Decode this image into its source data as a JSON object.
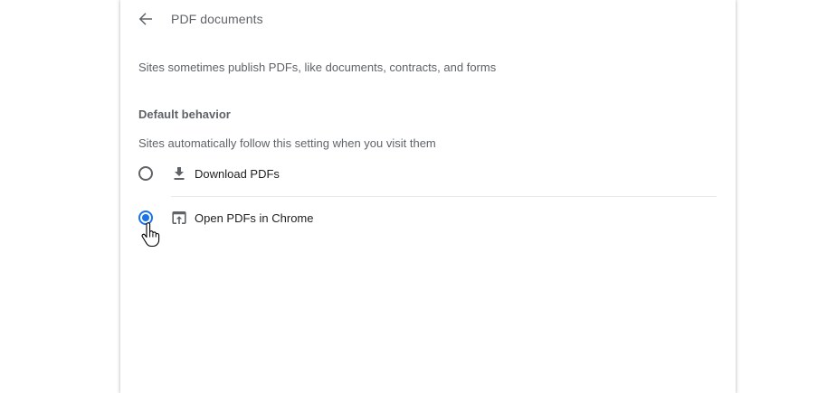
{
  "header": {
    "title": "PDF documents",
    "back_icon": "arrow-back-icon"
  },
  "description": "Sites sometimes publish PDFs, like documents, contracts, and forms",
  "default_behavior": {
    "title": "Default behavior",
    "subtitle": "Sites automatically follow this setting when you visit them",
    "options": [
      {
        "label": "Download PDFs",
        "icon": "download-icon",
        "selected": false
      },
      {
        "label": "Open PDFs in Chrome",
        "icon": "open-in-browser-icon",
        "selected": true
      }
    ]
  },
  "colors": {
    "accent": "#1a73e8",
    "secondary_text": "#5f6368",
    "primary_text": "#202124",
    "divider": "#e8eaed"
  }
}
